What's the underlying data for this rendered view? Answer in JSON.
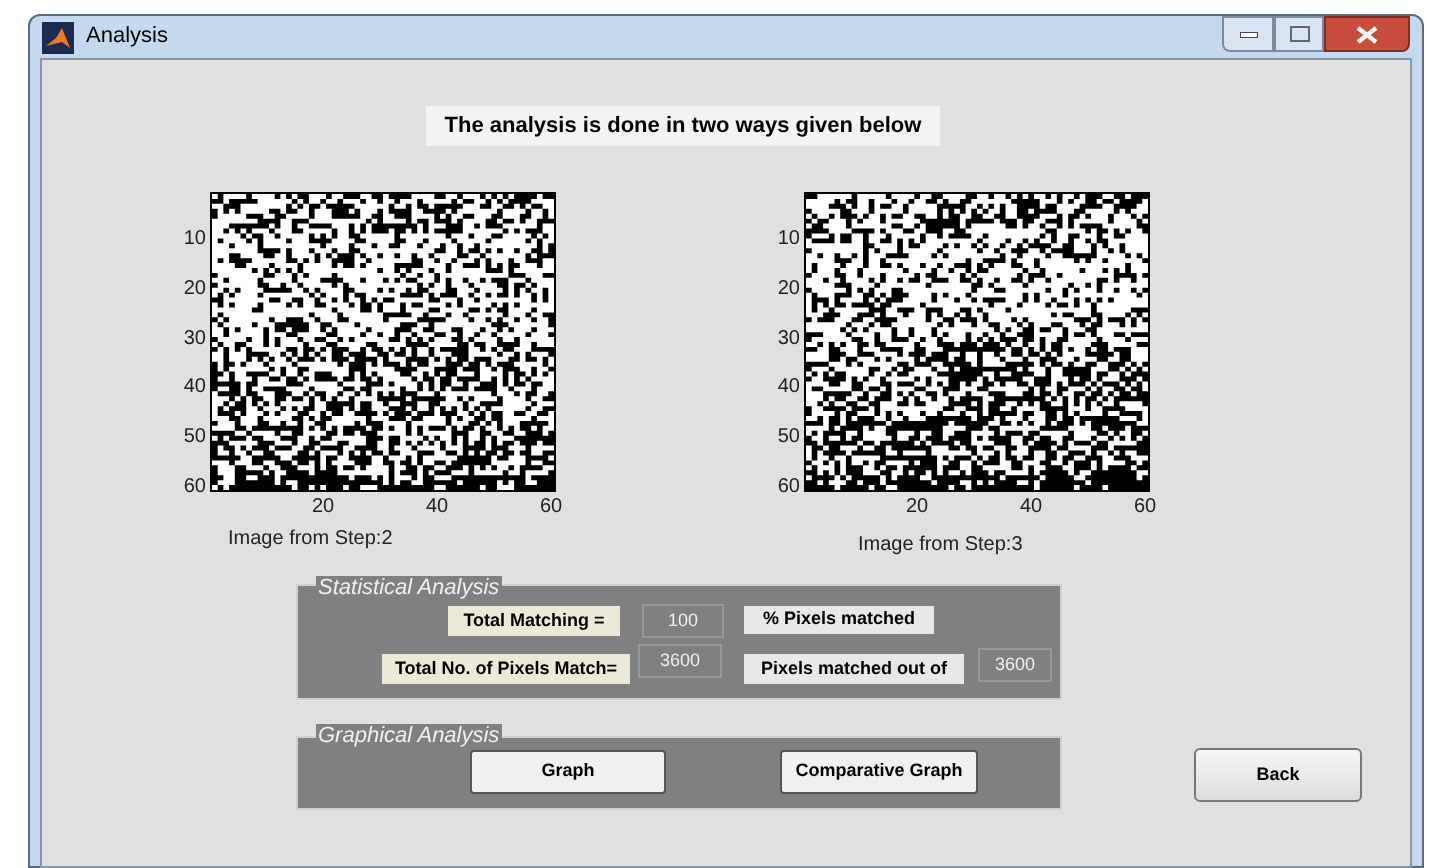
{
  "window": {
    "title": "Analysis"
  },
  "heading": "The analysis is done in two ways given below",
  "images": [
    {
      "yticks": [
        "10",
        "20",
        "30",
        "40",
        "50",
        "60"
      ],
      "xticks": [
        "20",
        "40",
        "60"
      ],
      "caption": "Image from Step:2"
    },
    {
      "yticks": [
        "10",
        "20",
        "30",
        "40",
        "50",
        "60"
      ],
      "xticks": [
        "20",
        "40",
        "60"
      ],
      "caption": "Image from Step:3"
    }
  ],
  "statistical_analysis": {
    "title": "Statistical Analysis",
    "total_matching": {
      "label": "Total Matching =",
      "value": "100",
      "unit": "% Pixels matched"
    },
    "total_pixels": {
      "label": "Total No. of Pixels Match=",
      "value": "3600",
      "unit": "Pixels matched out of",
      "total": "3600"
    }
  },
  "graphical_analysis": {
    "title": "Graphical Analysis",
    "buttons": [
      "Graph",
      "Comparative Graph"
    ]
  },
  "back_button": "Back"
}
